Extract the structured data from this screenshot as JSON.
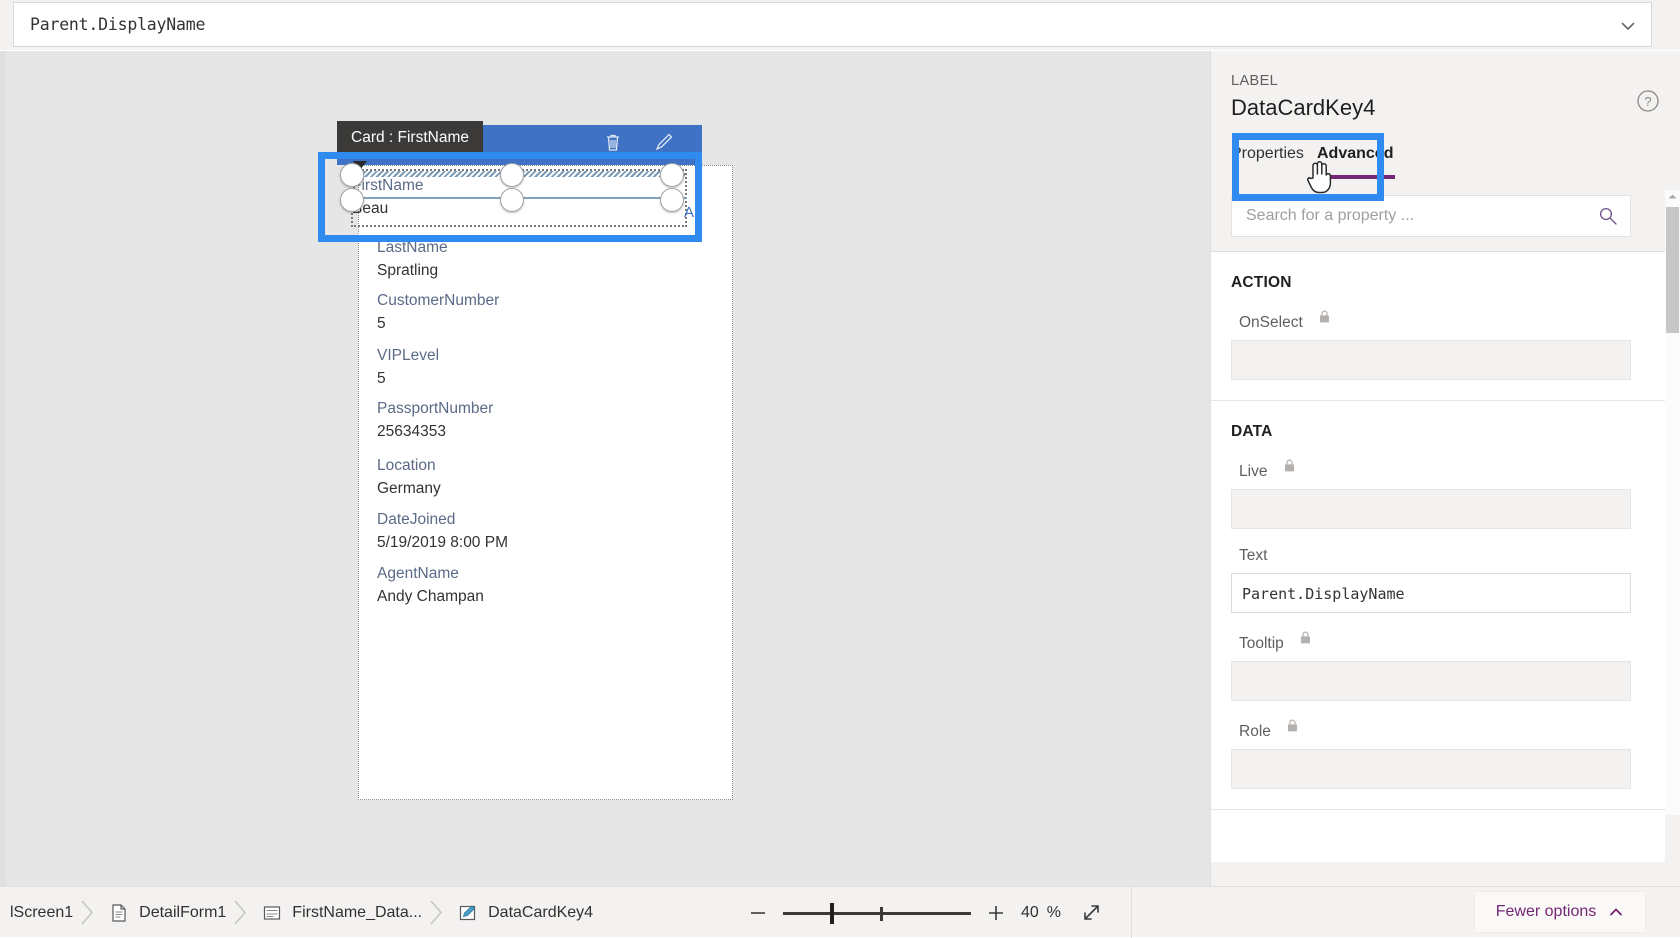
{
  "formula_bar": {
    "value": "Parent.DisplayName",
    "chevron_icon": "chevron-down-icon"
  },
  "canvas": {
    "card_tooltip": "Card : FirstName",
    "toolbar_icons": [
      "trash-icon",
      "pencil-icon"
    ],
    "selected_label_marker": "A",
    "selected_card": {
      "label": "FirstName",
      "value": "Beau"
    },
    "fields": [
      {
        "label": "LastName",
        "value": "Spratling"
      },
      {
        "label": "CustomerNumber",
        "value": "5"
      },
      {
        "label": "VIPLevel",
        "value": "5"
      },
      {
        "label": "PassportNumber",
        "value": "25634353"
      },
      {
        "label": "Location",
        "value": "Germany"
      },
      {
        "label": "DateJoined",
        "value": "5/19/2019 8:00 PM"
      },
      {
        "label": "AgentName",
        "value": "Andy Champan"
      }
    ]
  },
  "panel": {
    "kind": "LABEL",
    "title": "DataCardKey4",
    "help_icon": "help-circle-icon",
    "tabs": [
      {
        "label": "Properties",
        "active": false
      },
      {
        "label": "Advanced",
        "active": true
      }
    ],
    "search": {
      "placeholder": "Search for a property ...",
      "value": "",
      "icon": "search-icon"
    },
    "sections": [
      {
        "title": "ACTION",
        "rows": [
          {
            "label": "OnSelect",
            "locked": true,
            "value": ""
          }
        ]
      },
      {
        "title": "DATA",
        "rows": [
          {
            "label": "Live",
            "locked": true,
            "value": ""
          },
          {
            "label": "Text",
            "locked": false,
            "value": "Parent.DisplayName"
          },
          {
            "label": "Tooltip",
            "locked": true,
            "value": ""
          },
          {
            "label": "Role",
            "locked": true,
            "value": ""
          }
        ]
      }
    ],
    "accent_color": "#742774",
    "highlight_color": "#2f8bf0"
  },
  "bottom_bar": {
    "breadcrumb": [
      {
        "label": "lScreen1",
        "icon": ""
      },
      {
        "label": "DetailForm1",
        "icon": "document-icon"
      },
      {
        "label": "FirstName_Data...",
        "icon": "card-icon"
      },
      {
        "label": "DataCardKey4",
        "icon": "pencil-square-icon"
      }
    ],
    "zoom": {
      "minus_icon": "minus-icon",
      "plus_icon": "plus-icon",
      "value": "40",
      "percent": "%",
      "fit_icon": "fit-screen-icon"
    },
    "fewer_options": {
      "label": "Fewer options",
      "chevron_icon": "chevron-up-icon"
    }
  }
}
